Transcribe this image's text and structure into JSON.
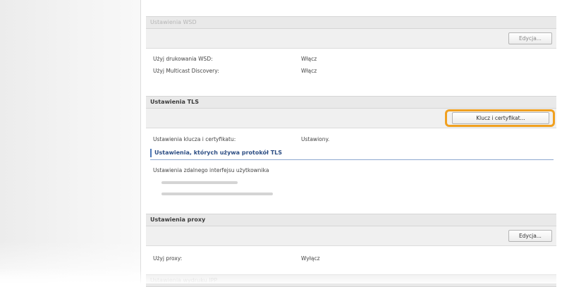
{
  "wsd": {
    "header": "Ustawienia WSD",
    "edit_label": "Edycja...",
    "rows": [
      {
        "label": "Użyj drukowania WSD:",
        "value": "Włącz"
      },
      {
        "label": "Użyj Multicast Discovery:",
        "value": "Włącz"
      }
    ]
  },
  "tls": {
    "header": "Ustawienia TLS",
    "key_button_label": "Klucz i certyfikat...",
    "rows": [
      {
        "label": "Ustawienia klucza i certyfikatu:",
        "value": "Ustawiony."
      }
    ],
    "subheading": "Ustawienia, których używa protokół TLS",
    "protocol_item": "Ustawienia zdalnego interfejsu użytkownika"
  },
  "proxy": {
    "header": "Ustawienia proxy",
    "edit_label": "Edycja...",
    "rows": [
      {
        "label": "Użyj proxy:",
        "value": "Wyłącz"
      }
    ]
  },
  "ipp": {
    "header": "Ustawienia wydruku IPP"
  },
  "colors": {
    "highlight": "#f0a020",
    "subheading": "#2d4e84"
  }
}
